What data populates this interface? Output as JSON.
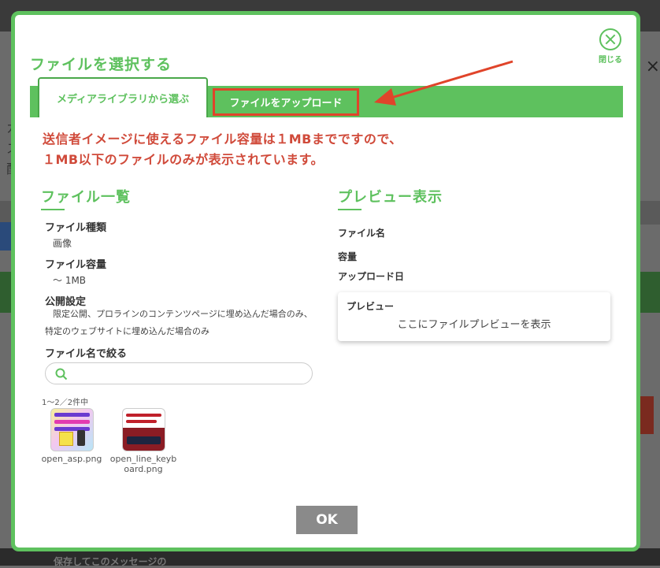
{
  "background": {
    "bottom_text": "保存してこのメッセージの",
    "chars": [
      "カ",
      "ス",
      "配"
    ]
  },
  "modal": {
    "title": "ファイルを選択する",
    "close_label": "閉じる",
    "tabs": [
      {
        "label": "メディアライブラリから選ぶ",
        "active": true
      },
      {
        "label": "ファイルをアップロード",
        "active": false
      }
    ],
    "warning_line1": "送信者イメージに使えるファイル容量は１MBまでですので、",
    "warning_line2": "１MB以下のファイルのみが表示されています。"
  },
  "file_list": {
    "title": "ファイル一覧",
    "type_label": "ファイル種類",
    "type_value": "画像",
    "size_label": "ファイル容量",
    "size_value": "～ 1MB",
    "visibility_label": "公開設定",
    "visibility_value_line1": "限定公開、プロラインのコンテンツページに埋め込んだ場合のみ、特定のウェブサイトに埋め込んだ場合のみ",
    "filter_label": "ファイル名で絞る",
    "search_placeholder": "",
    "count_text": "1〜2／2件中",
    "files": [
      {
        "name": "open_asp.png"
      },
      {
        "name": "open_line_keyboard.png"
      }
    ]
  },
  "preview": {
    "title": "プレビュー表示",
    "filename_label": "ファイル名",
    "size_label": "容量",
    "upload_date_label": "アップロード日",
    "card_title": "プレビュー",
    "card_text": "ここにファイルプレビューを表示"
  },
  "ok_label": "OK",
  "colors": {
    "accent": "#5ec15e",
    "warning": "#d04a3a",
    "highlight": "#e0442a",
    "ok_button": "#8a8a8a"
  }
}
